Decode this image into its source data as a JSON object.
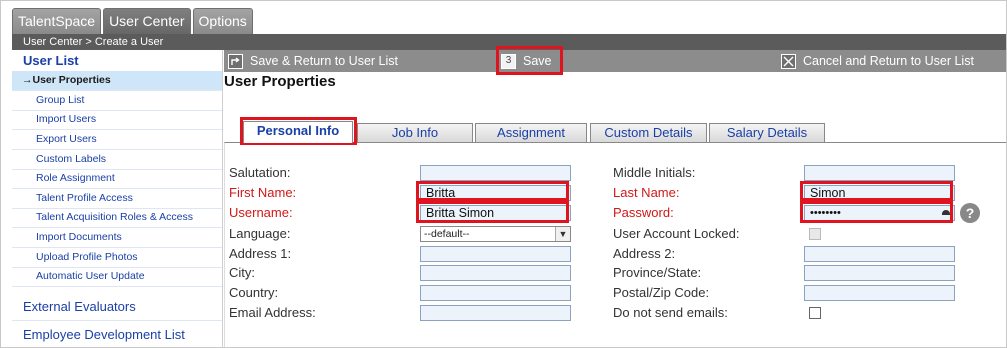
{
  "top_tabs": [
    "TalentSpace",
    "User Center",
    "Options"
  ],
  "breadcrumb": "User Center > Create a User",
  "sidebar": {
    "title": "User List",
    "items": [
      "→User Properties",
      "Group List",
      "Import Users",
      "Export Users",
      "Custom Labels",
      "Role Assignment",
      "Talent Profile Access",
      "Talent Acquisition Roles & Access",
      "Import Documents",
      "Upload Profile Photos",
      "Automatic User Update"
    ],
    "section_external": "External Evaluators",
    "section_partial": "Employee Development List"
  },
  "toolbar": {
    "save_return": "Save & Return to User List",
    "save": "Save",
    "save_icon_text": "3",
    "cancel_return": "Cancel and Return to User List"
  },
  "page_title": "User Properties",
  "form_tabs": [
    "Personal Info",
    "Job Info",
    "Assignment",
    "Custom Details",
    "Salary Details"
  ],
  "form": {
    "salutation": {
      "label": "Salutation:",
      "value": ""
    },
    "first_name": {
      "label": "First Name:",
      "value": "Britta"
    },
    "username": {
      "label": "Username:",
      "value": "Britta Simon"
    },
    "language": {
      "label": "Language:",
      "value": "--default--"
    },
    "address1": {
      "label": "Address 1:",
      "value": ""
    },
    "city": {
      "label": "City:",
      "value": ""
    },
    "country": {
      "label": "Country:",
      "value": ""
    },
    "email": {
      "label": "Email Address:",
      "value": ""
    },
    "middle_initials": {
      "label": "Middle Initials:",
      "value": ""
    },
    "last_name": {
      "label": "Last Name:",
      "value": "Simon"
    },
    "password": {
      "label": "Password:",
      "value": "••••••••"
    },
    "account_locked": {
      "label": "User Account Locked:"
    },
    "address2": {
      "label": "Address 2:",
      "value": ""
    },
    "province": {
      "label": "Province/State:",
      "value": ""
    },
    "postal": {
      "label": "Postal/Zip Code:",
      "value": ""
    },
    "no_emails": {
      "label": "Do not send emails:"
    },
    "help": "?"
  },
  "colors": {
    "highlight": "#e0141e",
    "required_label": "#d01818",
    "link": "#1a3fa6"
  }
}
